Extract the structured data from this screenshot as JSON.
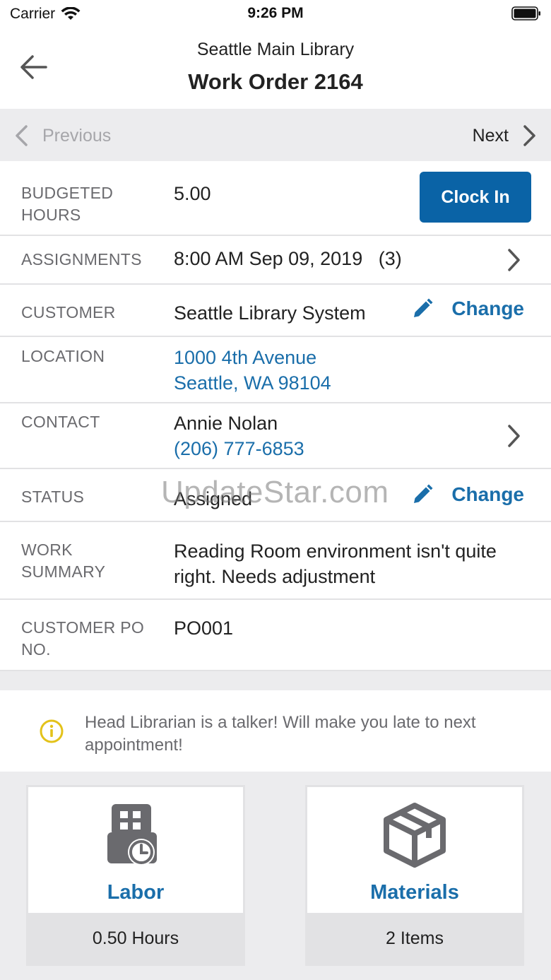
{
  "status_bar": {
    "carrier": "Carrier",
    "time": "9:26 PM"
  },
  "header": {
    "subtitle": "Seattle Main Library",
    "title": "Work Order 2164"
  },
  "pager": {
    "previous_label": "Previous",
    "next_label": "Next"
  },
  "details": {
    "budgeted_hours": {
      "label": "BUDGETED HOURS",
      "value": "5.00",
      "action": "Clock In"
    },
    "assignments": {
      "label": "ASSIGNMENTS",
      "value": "8:00 AM Sep 09, 2019",
      "count": "(3)"
    },
    "customer": {
      "label": "CUSTOMER",
      "value": "Seattle Library System",
      "action": "Change"
    },
    "location": {
      "label": "LOCATION",
      "line1": "1000 4th Avenue",
      "line2": "Seattle, WA 98104"
    },
    "contact": {
      "label": "CONTACT",
      "name": "Annie Nolan",
      "phone": "(206) 777-6853"
    },
    "status": {
      "label": "STATUS",
      "value": "Assigned",
      "action": "Change"
    },
    "work_summary": {
      "label": "WORK SUMMARY",
      "value": "Reading Room environment isn't quite right.  Needs adjustment"
    },
    "customer_po": {
      "label": "CUSTOMER PO NO.",
      "value": "PO001"
    }
  },
  "note": {
    "text": "Head Librarian is a talker!  Will make you late to next appointment!"
  },
  "tiles": {
    "labor": {
      "title": "Labor",
      "footer": "0.50 Hours",
      "icon": "labor-clock-icon"
    },
    "materials": {
      "title": "Materials",
      "footer": "2 Items",
      "icon": "box-icon"
    }
  },
  "watermark": "UpdateStar.com",
  "colors": {
    "accent": "#0a63a6",
    "link": "#1a6eaa",
    "info": "#e3c21a"
  }
}
